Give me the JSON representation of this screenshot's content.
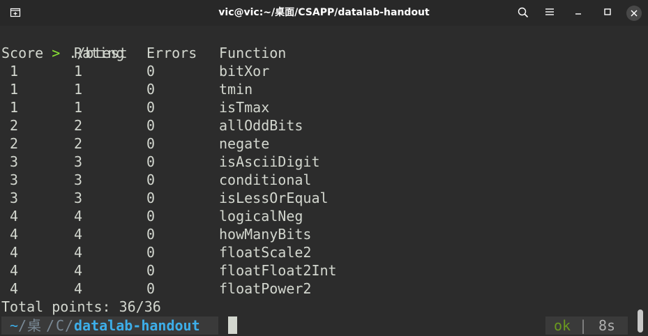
{
  "window": {
    "title": "vic@vic:~/桌面/CSAPP/datalab-handout"
  },
  "terminal": {
    "command_prompt_symbol": ">",
    "command": " ./btest",
    "headers": {
      "score": "Score",
      "rating": "Rating",
      "errors": "Errors",
      "function": "Function"
    },
    "rows": [
      {
        "score": " 1",
        "rating": "1",
        "errors": "0",
        "function": "bitXor"
      },
      {
        "score": " 1",
        "rating": "1",
        "errors": "0",
        "function": "tmin"
      },
      {
        "score": " 1",
        "rating": "1",
        "errors": "0",
        "function": "isTmax"
      },
      {
        "score": " 2",
        "rating": "2",
        "errors": "0",
        "function": "allOddBits"
      },
      {
        "score": " 2",
        "rating": "2",
        "errors": "0",
        "function": "negate"
      },
      {
        "score": " 3",
        "rating": "3",
        "errors": "0",
        "function": "isAsciiDigit"
      },
      {
        "score": " 3",
        "rating": "3",
        "errors": "0",
        "function": "conditional"
      },
      {
        "score": " 3",
        "rating": "3",
        "errors": "0",
        "function": "isLessOrEqual"
      },
      {
        "score": " 4",
        "rating": "4",
        "errors": "0",
        "function": "logicalNeg"
      },
      {
        "score": " 4",
        "rating": "4",
        "errors": "0",
        "function": "howManyBits"
      },
      {
        "score": " 4",
        "rating": "4",
        "errors": "0",
        "function": "floatScale2"
      },
      {
        "score": " 4",
        "rating": "4",
        "errors": "0",
        "function": "floatFloat2Int"
      },
      {
        "score": " 4",
        "rating": "4",
        "errors": "0",
        "function": "floatPower2"
      }
    ],
    "total": "Total points: 36/36",
    "prompt": {
      "tilde": " ~",
      "sep1": "/",
      "dir1": "桌",
      "sep2": "/",
      "dir2": "C",
      "sep3": "/",
      "current": "datalab-handout"
    },
    "status": {
      "ok": "ok",
      "sep": " | ",
      "duration": "8s"
    }
  },
  "colors": {
    "background": "#2c2c2c",
    "text": "#d3d7cf",
    "prompt_green": "#8ae234",
    "path_blue": "#3daee9",
    "path_dim": "#7a8a96",
    "ok_green": "#6a9a1f"
  }
}
